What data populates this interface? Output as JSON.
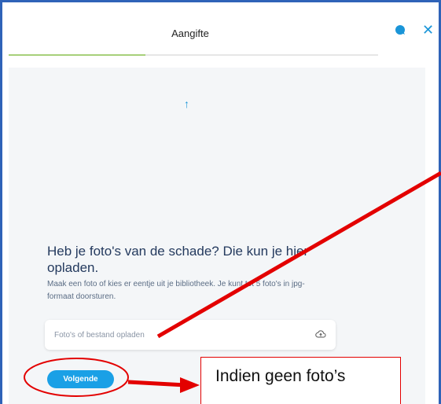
{
  "header": {
    "title": "Aangifte",
    "progress": 0.37
  },
  "step": {
    "heading": "Heb je foto's van de schade? Die kun je hier opladen.",
    "description": "Maak een foto of kies er eentje uit je bibliotheek. Je kunt tot 5 foto's in jpg-formaat doorsturen."
  },
  "upload": {
    "placeholder": "Foto's of bestand opladen",
    "icon": "cloud-upload-icon"
  },
  "actions": {
    "next_label": "Volgende"
  },
  "annotation": {
    "note": "Indien geen foto’s"
  },
  "colors": {
    "accent": "#1aa0e6",
    "progress": "#a7d07a",
    "heading": "#243a5e",
    "annotation": "#e30000",
    "frame": "#2f63b8"
  }
}
